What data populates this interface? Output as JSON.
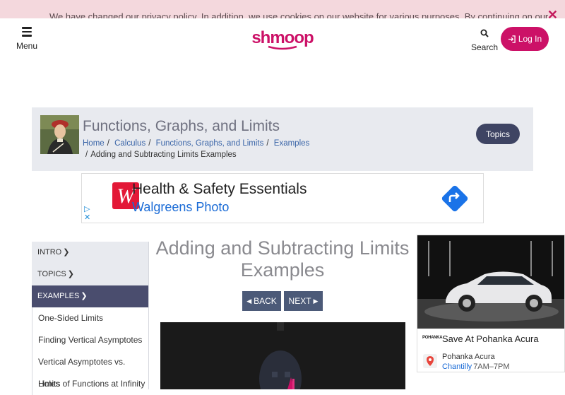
{
  "cookie_banner": {
    "text": "We have changed our privacy policy. In addition, we use cookies on our website for various purposes. By continuing on our",
    "close_icon": "close-icon"
  },
  "header": {
    "menu_label": "Menu",
    "logo_text": "shmoop",
    "search_label": "Search",
    "login_label": "Log In",
    "brand_color": "#cc1167"
  },
  "breadcrumb": {
    "title": "Functions, Graphs, and Limits",
    "items": [
      "Home",
      "Calculus",
      "Functions, Graphs, and Limits",
      "Examples"
    ],
    "current": "Adding and Subtracting Limits Examples",
    "topics_label": "Topics"
  },
  "ad_banner": {
    "title": "Health & Safety Essentials",
    "subtitle": "Walgreens Photo",
    "arrow_icon": "directions-arrow-icon"
  },
  "sidenav": {
    "sections": [
      {
        "label": "INTRO",
        "active": false
      },
      {
        "label": "TOPICS",
        "active": false
      },
      {
        "label": "EXAMPLES",
        "active": true
      }
    ],
    "items": [
      "One-Sided Limits",
      "Finding Vertical Asymptotes",
      "Vertical Asymptotes vs. Holes",
      "Limits of Functions at Infinity"
    ]
  },
  "main": {
    "page_title": "Adding and Subtracting Limits Examples",
    "back_label": "BACK",
    "next_label": "NEXT"
  },
  "side_ad": {
    "title": "Save At Pohanka Acura",
    "badge": "POHANKA",
    "dealer_name": "Pohanka Acura",
    "dealer_city": "Chantilly",
    "dealer_hours": "7AM–7PM"
  }
}
